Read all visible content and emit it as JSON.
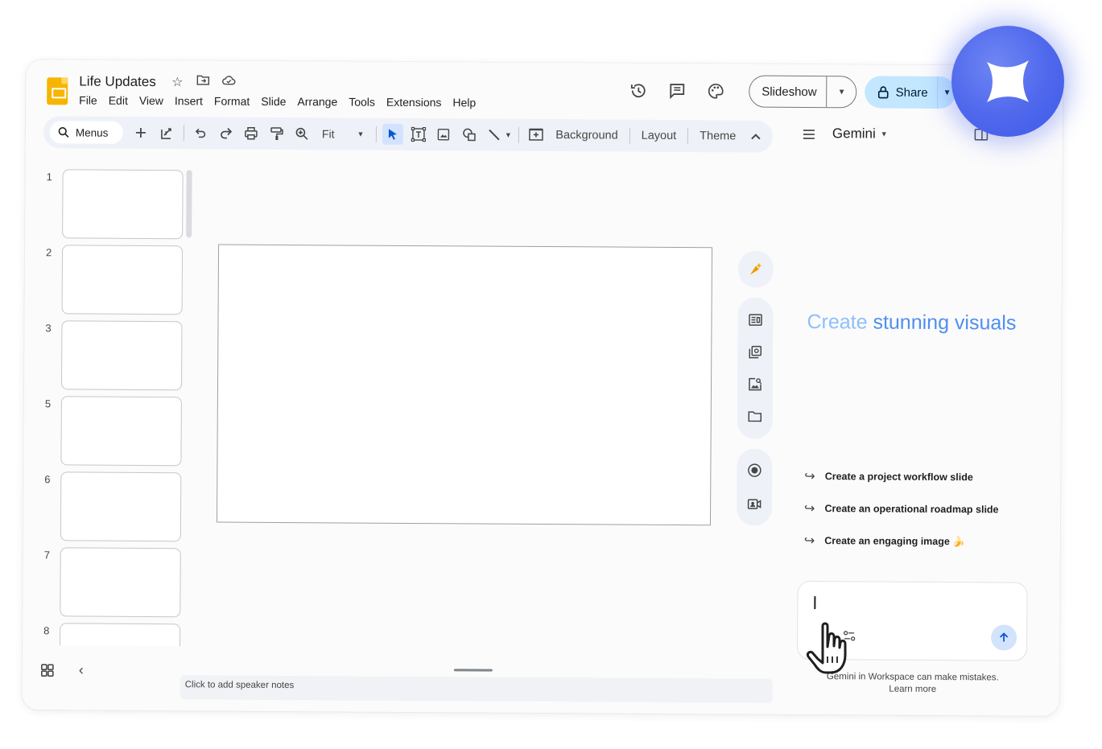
{
  "document": {
    "title": "Life Updates"
  },
  "menubar": [
    "File",
    "Edit",
    "View",
    "Insert",
    "Format",
    "Slide",
    "Arrange",
    "Tools",
    "Extensions",
    "Help"
  ],
  "header": {
    "slideshow_label": "Slideshow",
    "share_label": "Share"
  },
  "toolbar": {
    "search_label": "Menus",
    "zoom_label": "Fit",
    "background_label": "Background",
    "layout_label": "Layout",
    "theme_label": "Theme"
  },
  "filmstrip": {
    "slide_numbers": [
      "1",
      "2",
      "3",
      "5",
      "6",
      "7",
      "8"
    ]
  },
  "notes": {
    "placeholder": "Click to add speaker notes"
  },
  "gemini": {
    "title": "Gemini",
    "headline_part1": "Create",
    "headline_part2": "stunning visuals",
    "suggestions": [
      "Create a project workflow slide",
      "Create an operational roadmap slide",
      "Create an engaging image 🍌"
    ],
    "footer_line1": "Gemini in Workspace can make mistakes.",
    "footer_line2": "Learn more"
  },
  "colors": {
    "accent": "#0b57d0",
    "share_bg": "#c2e7ff",
    "logo": "#f6b500",
    "badge": "#4e67ec"
  }
}
